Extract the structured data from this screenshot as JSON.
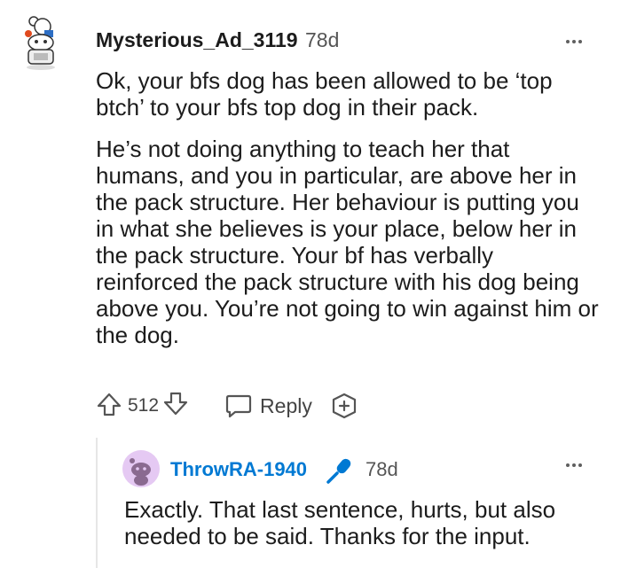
{
  "comment": {
    "username": "Mysterious_Ad_3119",
    "age": "78d",
    "paragraphs": [
      "Ok, your bfs dog has been allowed to be ‘top btch’ to your bfs top dog in their pack.",
      "He’s not doing anything to teach her that humans, and you in particular, are above her in the pack structure. Her behaviour is putting you in what she believes is your place, below her in the pack structure. Your bf has verbally reinforced the pack structure with his dog being above you. You’re not going to win against him or the dog."
    ],
    "votes": "512",
    "reply_label": "Reply",
    "avatar_icon": "snoo-avatar-icon",
    "menu_icon": "more-options-icon"
  },
  "reply": {
    "username": "ThrowRA-1940",
    "badge_icon": "microphone-icon",
    "age": "78d",
    "text": "Exactly. That last sentence, hurts, but also needed to be said. Thanks for the input.",
    "avatar_icon": "default-avatar-icon"
  },
  "colors": {
    "reply_username": "#0079d3",
    "avatar2_bg": "#e5c9f3",
    "mic": "#0079d3"
  }
}
